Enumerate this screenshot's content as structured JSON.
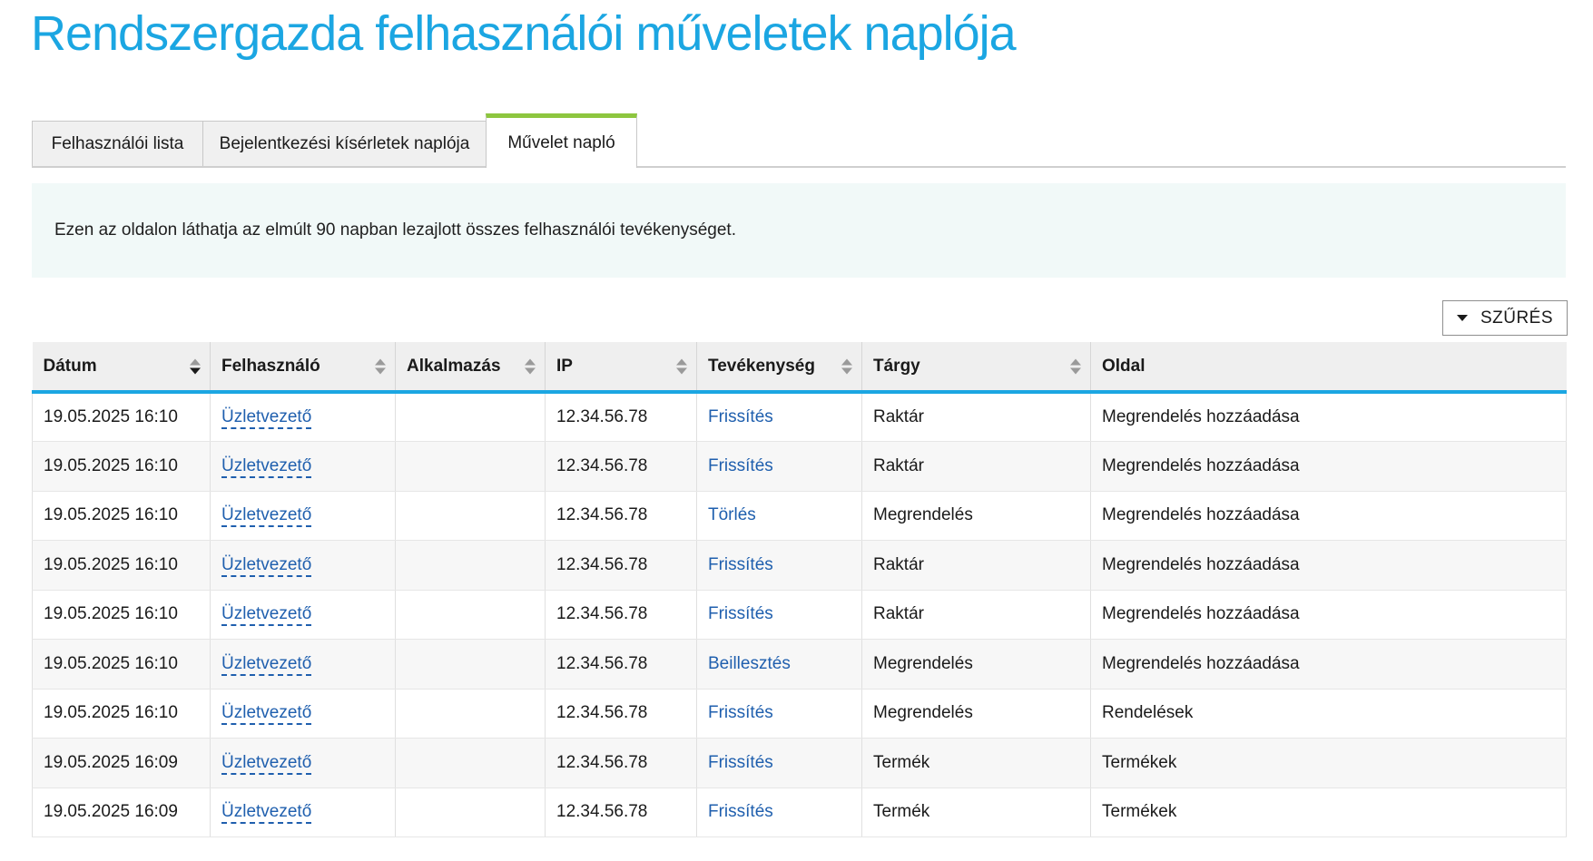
{
  "page": {
    "title": "Rendszergazda felhasználói műveletek naplója"
  },
  "tabs": [
    {
      "label": "Felhasználói lista"
    },
    {
      "label": "Bejelentkezési kísérletek naplója"
    },
    {
      "label": "Művelet napló"
    }
  ],
  "info": {
    "text": "Ezen az oldalon láthatja az elmúlt 90 napban lezajlott összes felhasználói tevékenységet."
  },
  "filter": {
    "label": "SZŰRÉS"
  },
  "colors": {
    "title": "#1ba6e2",
    "active_tab": "#8dc63f",
    "header_rule": "#1ba6e2",
    "link": "#1f5fae"
  },
  "table": {
    "columns": [
      "Dátum",
      "Felhasználó",
      "Alkalmazás",
      "IP",
      "Tevékenység",
      "Tárgy",
      "Oldal"
    ],
    "rows": [
      {
        "date": "19.05.2025 16:10",
        "user": "Üzletvezető",
        "app": "",
        "ip": "12.34.56.78",
        "activity": "Frissítés",
        "subject": "Raktár",
        "page": "Megrendelés hozzáadása"
      },
      {
        "date": "19.05.2025 16:10",
        "user": "Üzletvezető",
        "app": "",
        "ip": "12.34.56.78",
        "activity": "Frissítés",
        "subject": "Raktár",
        "page": "Megrendelés hozzáadása"
      },
      {
        "date": "19.05.2025 16:10",
        "user": "Üzletvezető",
        "app": "",
        "ip": "12.34.56.78",
        "activity": "Törlés",
        "subject": "Megrendelés",
        "page": "Megrendelés hozzáadása"
      },
      {
        "date": "19.05.2025 16:10",
        "user": "Üzletvezető",
        "app": "",
        "ip": "12.34.56.78",
        "activity": "Frissítés",
        "subject": "Raktár",
        "page": "Megrendelés hozzáadása"
      },
      {
        "date": "19.05.2025 16:10",
        "user": "Üzletvezető",
        "app": "",
        "ip": "12.34.56.78",
        "activity": "Frissítés",
        "subject": "Raktár",
        "page": "Megrendelés hozzáadása"
      },
      {
        "date": "19.05.2025 16:10",
        "user": "Üzletvezető",
        "app": "",
        "ip": "12.34.56.78",
        "activity": "Beillesztés",
        "subject": "Megrendelés",
        "page": "Megrendelés hozzáadása"
      },
      {
        "date": "19.05.2025 16:10",
        "user": "Üzletvezető",
        "app": "",
        "ip": "12.34.56.78",
        "activity": "Frissítés",
        "subject": "Megrendelés",
        "page": "Rendelések"
      },
      {
        "date": "19.05.2025 16:09",
        "user": "Üzletvezető",
        "app": "",
        "ip": "12.34.56.78",
        "activity": "Frissítés",
        "subject": "Termék",
        "page": "Termékek"
      },
      {
        "date": "19.05.2025 16:09",
        "user": "Üzletvezető",
        "app": "",
        "ip": "12.34.56.78",
        "activity": "Frissítés",
        "subject": "Termék",
        "page": "Termékek"
      }
    ]
  }
}
